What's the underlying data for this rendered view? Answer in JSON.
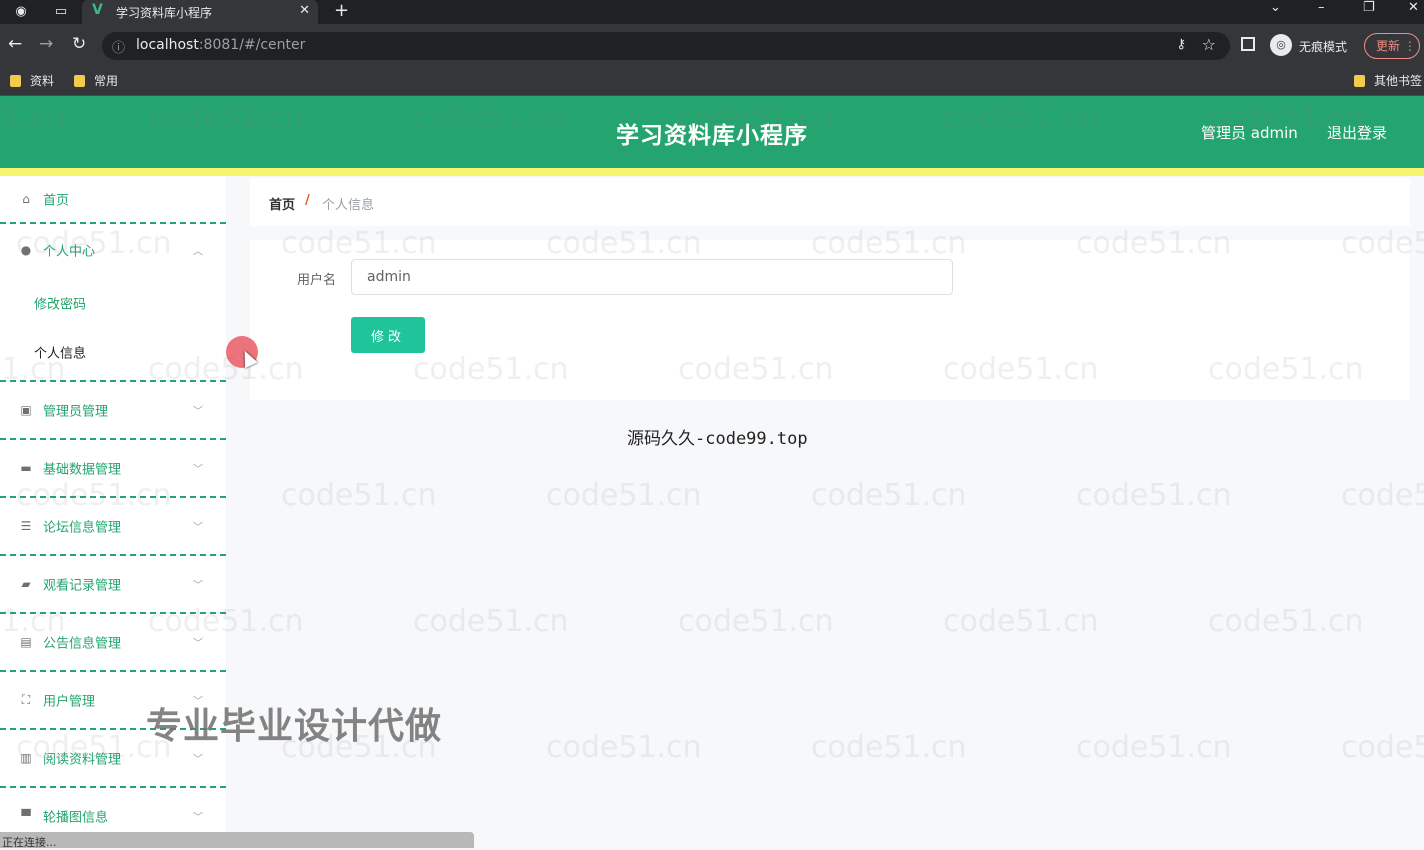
{
  "browser": {
    "tab_title": "学习资料库小程序",
    "tab_close": "✕",
    "new_tab": "+",
    "url_host": "localhost",
    "url_rest": ":8081/#/center",
    "incognito_label": "无痕模式",
    "update_label": "更新",
    "bookmarks": [
      "资料",
      "常用",
      "其他书签"
    ]
  },
  "header": {
    "title": "学习资料库小程序",
    "user_label": "管理员 admin",
    "logout_label": "退出登录"
  },
  "sidebar": {
    "home": "首页",
    "personal_center": "个人中心",
    "sub_items": [
      "修改密码",
      "个人信息"
    ],
    "menus": [
      "管理员管理",
      "基础数据管理",
      "论坛信息管理",
      "观看记录管理",
      "公告信息管理",
      "用户管理",
      "阅读资料管理",
      "轮播图信息"
    ]
  },
  "breadcrumb": {
    "home": "首页",
    "separator": "/",
    "current": "个人信息"
  },
  "form": {
    "username_label": "用户名",
    "username_value": "admin",
    "submit_label": "修改"
  },
  "source_note": "源码久久-code99.top",
  "watermark_text": "code51.cn",
  "promo_text": "专业毕业设计代做",
  "status_text": "正在连接...",
  "colors": {
    "header_green": "#24a46e",
    "yellow_strip": "#f7f46d",
    "button_teal": "#1fc49a",
    "breadcrumb_separator": "#e0582a"
  }
}
